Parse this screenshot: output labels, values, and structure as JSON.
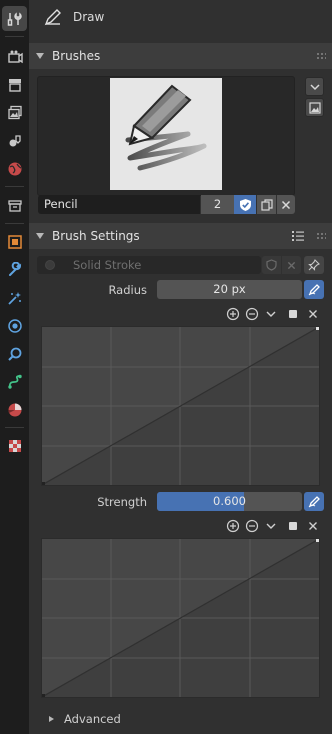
{
  "tool": {
    "title": "Draw"
  },
  "tabs": [
    {
      "name": "tool-settings-tab",
      "icon": "tool-icon",
      "active": true
    },
    {
      "name": "render-tab",
      "icon": "render-icon"
    },
    {
      "name": "output-tab",
      "icon": "output-icon"
    },
    {
      "name": "view-layer-tab",
      "icon": "view-layer-icon"
    },
    {
      "name": "scene-tab",
      "icon": "scene-icon"
    },
    {
      "name": "world-tab",
      "icon": "world-icon"
    },
    {
      "name": "collection-tab",
      "icon": "collection-icon"
    },
    {
      "name": "object-tab",
      "icon": "object-icon"
    },
    {
      "name": "modifiers-tab",
      "icon": "wrench-icon"
    },
    {
      "name": "particles-tab",
      "icon": "particles-icon"
    },
    {
      "name": "physics-tab",
      "icon": "physics-icon"
    },
    {
      "name": "constraints-tab",
      "icon": "constraints-icon"
    },
    {
      "name": "data-tab",
      "icon": "grease-pencil-data-icon"
    },
    {
      "name": "material-tab",
      "icon": "material-icon"
    },
    {
      "name": "texture-tab",
      "icon": "texture-icon"
    }
  ],
  "brushes_panel": {
    "header": "Brushes",
    "brush_name": "Pencil",
    "users": "2"
  },
  "brush_settings": {
    "header": "Brush Settings",
    "material_placeholder": "Solid Stroke",
    "radius_label": "Radius",
    "radius_value": "20 px",
    "strength_label": "Strength",
    "strength_value": "0.600",
    "strength_fraction": 0.6,
    "advanced_label": "Advanced"
  },
  "colors": {
    "accent": "#4772b3",
    "panel_bg": "#303030",
    "header_bg": "#3d3d3d",
    "tabstrip_bg": "#1d1d1d"
  }
}
